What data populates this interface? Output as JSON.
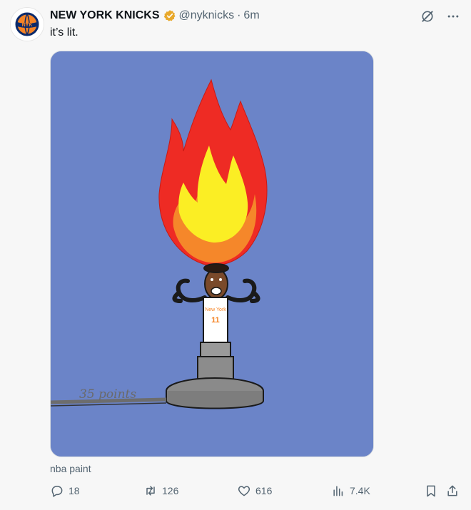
{
  "account": {
    "name": "NEW YORK KNICKS",
    "handle": "@nyknicks",
    "separator": "·",
    "time": "6m",
    "verified_color": "#e8a82b",
    "avatar_logo_text": "NYK"
  },
  "post": {
    "text": "it’s lit.",
    "media_caption": "nba paint",
    "media_bg": "#6b84c8",
    "image_text": {
      "jersey_team": "New York",
      "jersey_number": "11",
      "signature": "35 points"
    }
  },
  "actions": {
    "replies": "18",
    "reposts": "126",
    "likes": "616",
    "views": "7.4K"
  },
  "icons": [
    "grok-icon",
    "more-icon",
    "reply-icon",
    "repost-icon",
    "like-icon",
    "views-icon",
    "bookmark-icon",
    "share-icon"
  ]
}
